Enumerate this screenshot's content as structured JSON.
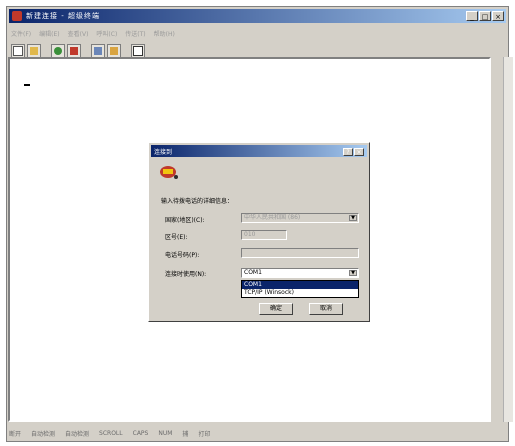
{
  "window": {
    "title": "新建连接 - 超级终端",
    "menu": [
      "文件(F)",
      "编辑(E)",
      "查看(V)",
      "呼叫(C)",
      "传送(T)",
      "帮助(H)"
    ],
    "controls": {
      "minimize": "_",
      "maximize": "□",
      "close": "×"
    }
  },
  "toolbar": {
    "icons": [
      "new-icon",
      "open-icon",
      "connect-icon",
      "disconnect-icon",
      "send-icon",
      "receive-icon",
      "properties-icon"
    ]
  },
  "statusbar": {
    "items": [
      "断开",
      "自动检测",
      "自动检测",
      "SCROLL",
      "CAPS",
      "NUM",
      "捕",
      "打印"
    ]
  },
  "dialog": {
    "title": "连接到",
    "icon": "phone-icon",
    "controls": {
      "help": "?",
      "close": "×"
    },
    "prompt": "输入待拨电话的详细信息：",
    "fields": {
      "country": {
        "label": "国家(地区)(C):",
        "value": "中华人民共和国 (86)"
      },
      "area": {
        "label": "区号(E):",
        "value": "010"
      },
      "phone": {
        "label": "电话号码(P):",
        "value": ""
      },
      "connect": {
        "label": "连接时使用(N):",
        "value": "COM1"
      }
    },
    "dropdown_options": [
      "COM1",
      "TCP/IP (Winsock)"
    ],
    "buttons": {
      "ok": "确定",
      "cancel": "取消"
    }
  },
  "colors": {
    "titlebar_start": "#0a246a",
    "titlebar_end": "#a6caf0",
    "window_bg": "#d4d0c8",
    "terminal_bg": "#ffffff"
  }
}
